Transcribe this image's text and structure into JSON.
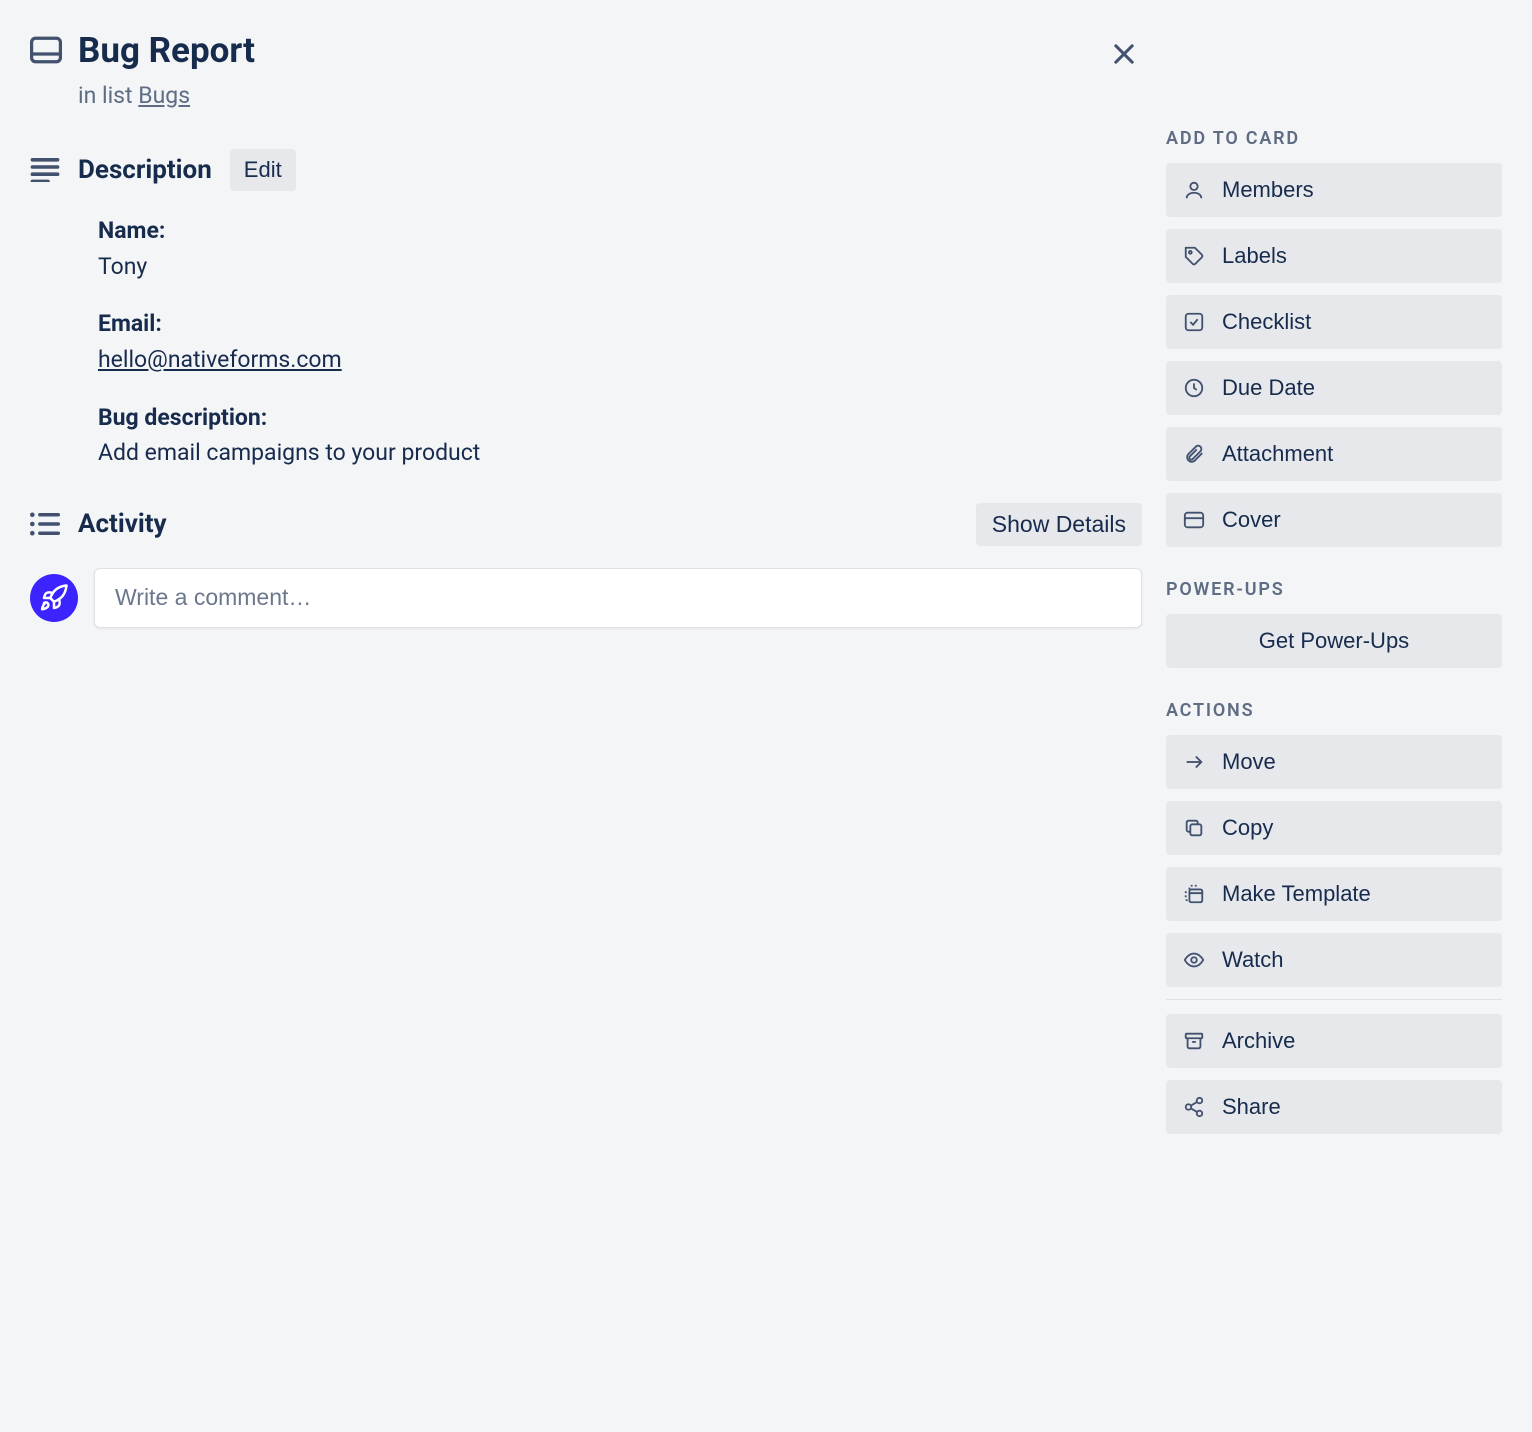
{
  "header": {
    "title": "Bug Report",
    "in_list_prefix": "in list ",
    "list_name": "Bugs"
  },
  "description": {
    "heading": "Description",
    "edit_label": "Edit",
    "fields": {
      "name_label": "Name:",
      "name_value": "Tony",
      "email_label": "Email:",
      "email_value": "hello@nativeforms.com",
      "bug_label": "Bug description:",
      "bug_value": "Add email campaigns to your product"
    }
  },
  "activity": {
    "heading": "Activity",
    "show_details_label": "Show Details",
    "comment_placeholder": "Write a comment…"
  },
  "sidebar": {
    "add_to_card_heading": "ADD TO CARD",
    "add_to_card": {
      "members": "Members",
      "labels": "Labels",
      "checklist": "Checklist",
      "due_date": "Due Date",
      "attachment": "Attachment",
      "cover": "Cover"
    },
    "power_ups_heading": "POWER-UPS",
    "power_ups": {
      "get": "Get Power-Ups"
    },
    "actions_heading": "ACTIONS",
    "actions": {
      "move": "Move",
      "copy": "Copy",
      "make_template": "Make Template",
      "watch": "Watch",
      "archive": "Archive",
      "share": "Share"
    }
  }
}
